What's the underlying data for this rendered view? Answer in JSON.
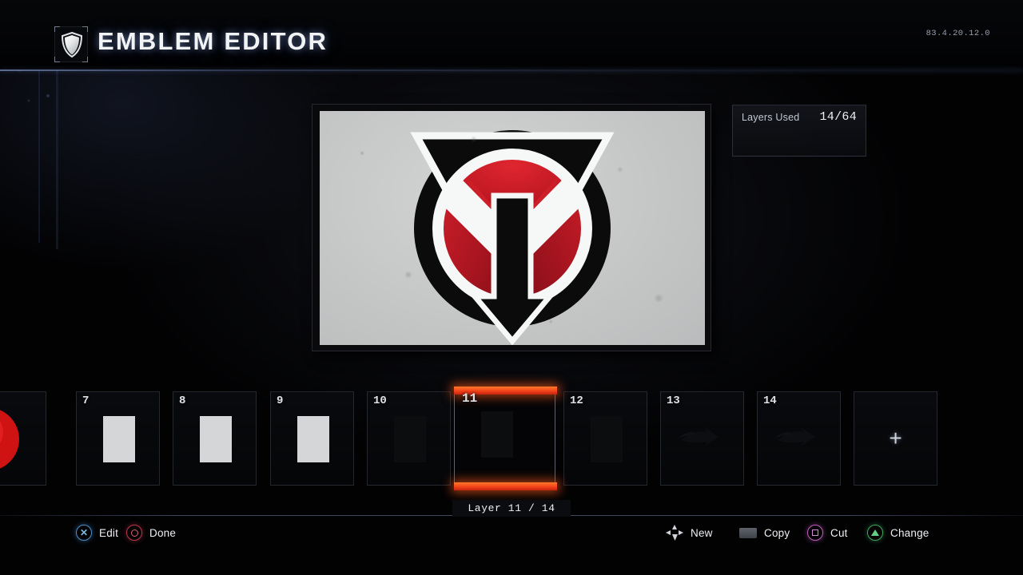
{
  "header": {
    "title": "EMBLEM EDITOR",
    "shield_icon": "shield-icon",
    "build_version": "83.4.20.12.0"
  },
  "layers_panel": {
    "label": "Layers Used",
    "value": "14/64"
  },
  "emblem": {
    "canvas_background": "#c7c8c9",
    "colors": {
      "black": "#0b0b0c",
      "white": "#f6f7f7",
      "red_bright": "#d6202a",
      "red_dark": "#8b0f18"
    }
  },
  "layer_strip": {
    "tiles": [
      {
        "number": "",
        "thumb": "red-sphere",
        "selected": false,
        "partial": true
      },
      {
        "number": "7",
        "thumb": "light-rect",
        "selected": false
      },
      {
        "number": "8",
        "thumb": "light-rect",
        "selected": false
      },
      {
        "number": "9",
        "thumb": "light-rect",
        "selected": false
      },
      {
        "number": "10",
        "thumb": "dark-rect",
        "selected": false
      },
      {
        "number": "11",
        "thumb": "dark-rect",
        "selected": true
      },
      {
        "number": "12",
        "thumb": "dark-rect",
        "selected": false
      },
      {
        "number": "13",
        "thumb": "dark-arrow",
        "selected": false
      },
      {
        "number": "14",
        "thumb": "dark-arrow",
        "selected": false
      }
    ],
    "add_tile": {
      "icon": "plus-icon",
      "label": "+"
    },
    "caption": "Layer 11 / 14",
    "selected_accent": "#f4431a"
  },
  "action_bar": {
    "left": [
      {
        "label": "Edit",
        "icon": "cross-button-icon",
        "glyph": "✕",
        "color": "#7fb8e2"
      },
      {
        "label": "Done",
        "icon": "circle-button-icon",
        "glyph": "○",
        "color": "#e06072"
      }
    ],
    "right": [
      {
        "label": "New",
        "icon": "dpad-icon",
        "color": "#cfd3da"
      },
      {
        "label": "Copy",
        "icon": "touchpad-icon",
        "color": "#5e626a"
      },
      {
        "label": "Cut",
        "icon": "square-button-icon",
        "color": "#d487d2"
      },
      {
        "label": "Change",
        "icon": "triangle-button-icon",
        "color": "#63cf84"
      }
    ]
  }
}
